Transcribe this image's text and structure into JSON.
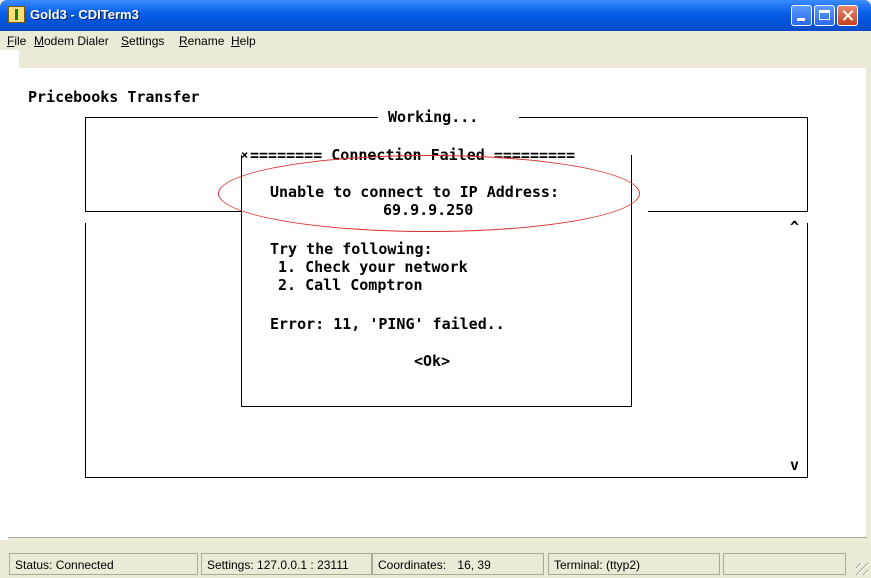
{
  "window": {
    "title": "Gold3 - CDITerm3"
  },
  "menu": [
    {
      "label": "File",
      "accel": "F",
      "rest": "ile"
    },
    {
      "label": "Modem Dialer",
      "accel": "M",
      "rest": "odem Dialer"
    },
    {
      "label": "Settings",
      "accel": "S",
      "rest": "ettings"
    },
    {
      "label": "Rename",
      "accel": "R",
      "rest": "ename"
    },
    {
      "label": "Help",
      "accel": "H",
      "rest": "elp"
    }
  ],
  "terminal": {
    "heading": "Pricebooks Transfer",
    "status_frame_title": "Working...",
    "scroll_up": "^",
    "scroll_down": "v"
  },
  "dialog": {
    "title": "======== Connection Failed =========",
    "close_mark": "×",
    "message_line1": "Unable to connect to IP Address:",
    "message_line2": "69.9.9.250",
    "suggest_heading": "Try the following:",
    "suggest_items": [
      "1. Check your network",
      "2. Call Comptron"
    ],
    "error": "Error: 11, 'PING' failed..",
    "ok_button": "<Ok>"
  },
  "statusbar": {
    "status": "Status:  Connected",
    "settings": "Settings: 127.0.0.1 : 23111",
    "coordinates_label": "Coordinates:",
    "coordinates_value": "16, 39",
    "terminal": "Terminal: (ttyp2)"
  },
  "colors": {
    "highlight_oval": "#d8322e",
    "titlebar": "#0454D8"
  }
}
